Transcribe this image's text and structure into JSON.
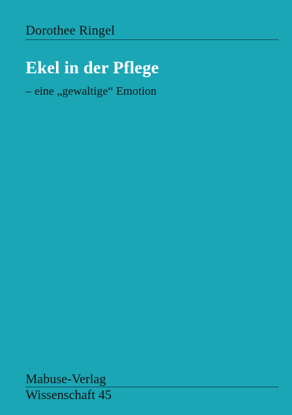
{
  "cover": {
    "author": "Dorothee Ringel",
    "title": "Ekel in der Pflege",
    "subtitle": "– eine „gewaltige“ Emotion",
    "publisher": "Mabuse-Verlag",
    "series": "Wissenschaft 45"
  },
  "colors": {
    "background": "#1aa6b5",
    "title_text": "#ffffff",
    "body_text": "#111111"
  }
}
